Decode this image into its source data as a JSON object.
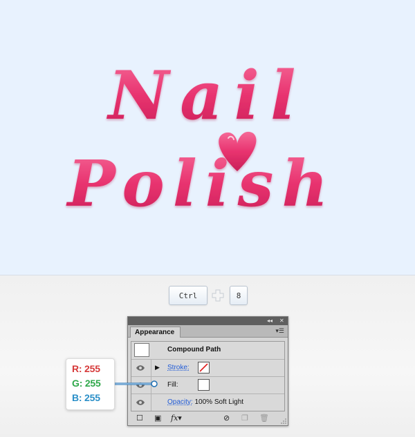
{
  "artwork": {
    "line1": "Nail",
    "line2": "Polish",
    "text_color": "#e8336f",
    "background_color": "#e8f2fe"
  },
  "shortcut": {
    "key1": "Ctrl",
    "key2": "8"
  },
  "panel": {
    "tab_title": "Appearance",
    "object_type": "Compound Path",
    "stroke_label": "Stroke:",
    "fill_label": "Fill:",
    "opacity_label": "Opacity:",
    "opacity_value": "100% Soft Light",
    "icons": [
      "eye-icon",
      "expand-triangle-icon",
      "new-stroke-icon",
      "new-fill-icon",
      "fx-icon",
      "clear-icon",
      "duplicate-icon",
      "delete-icon"
    ]
  },
  "callout": {
    "r": "R: 255",
    "g": "G: 255",
    "b": "B: 255",
    "r_color": "#d63a3a",
    "g_color": "#2fa84a",
    "b_color": "#2a8fc8"
  }
}
